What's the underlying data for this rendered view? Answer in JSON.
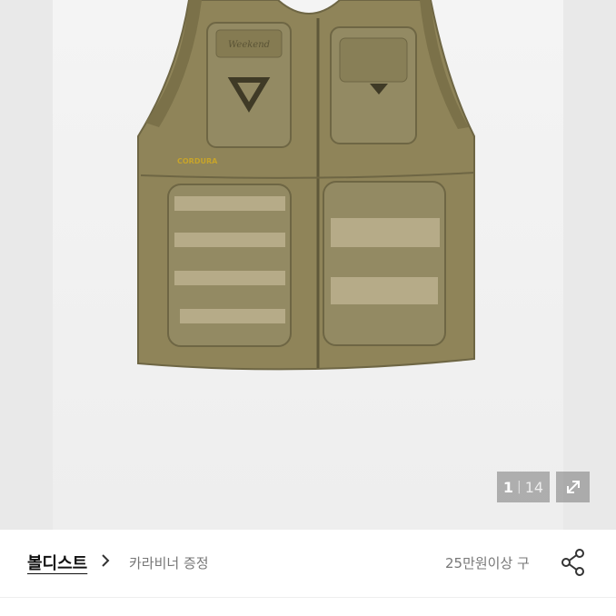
{
  "gallery": {
    "current": "1",
    "separator": "|",
    "total": "14",
    "expand_icon": "expand-icon",
    "image_text": {
      "front_logo": "CORDURA",
      "pocket_label": "Weekend"
    }
  },
  "store_bar": {
    "store_name": "볼디스트",
    "promo_1": "카라비너 증정",
    "promo_2": "25만원이상 구",
    "share_icon": "share-icon"
  }
}
